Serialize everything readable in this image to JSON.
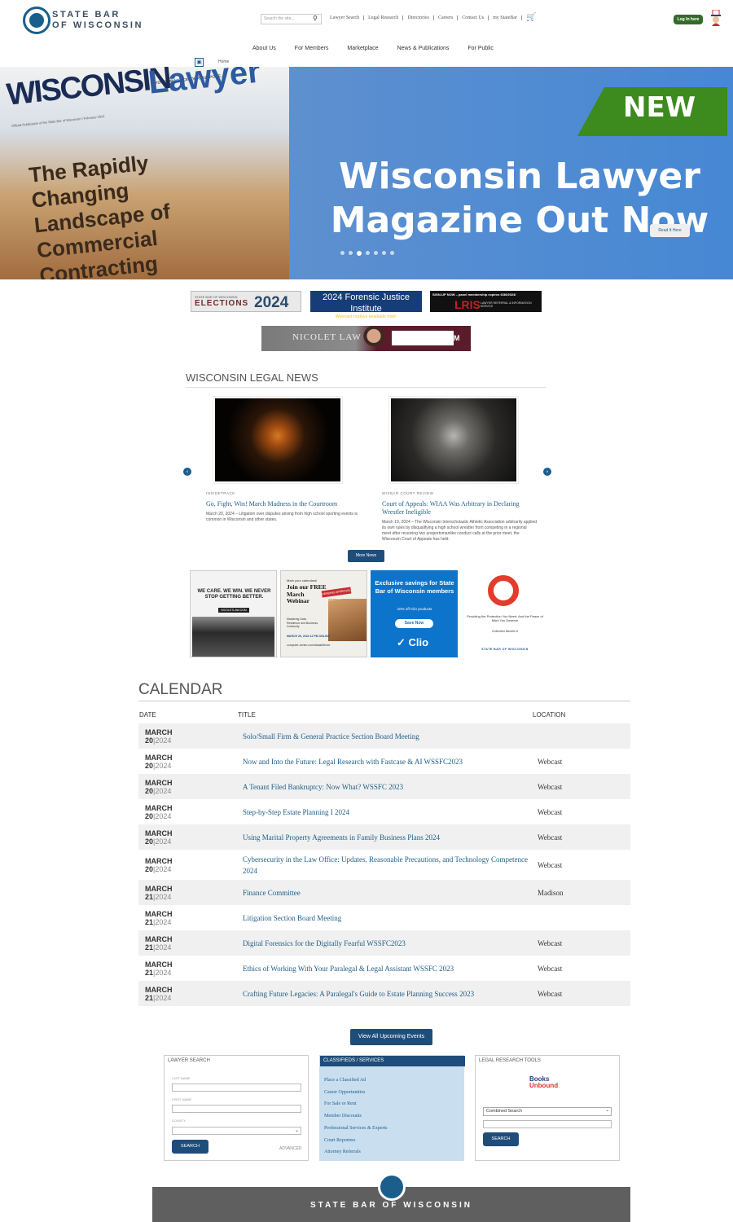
{
  "header": {
    "logo_line1": "STATE BAR",
    "logo_line2": "OF WISCONSIN",
    "search_placeholder": "Search the site...",
    "top_links": [
      "Lawyer Search",
      "Legal Research",
      "Directories",
      "Careers",
      "Contact Us",
      "my StateBar"
    ],
    "login_label": "Log In here"
  },
  "nav": {
    "items": [
      "About Us",
      "For Members",
      "Marketplace",
      "News & Publications",
      "For Public"
    ]
  },
  "breadcrumb": {
    "home": "Home"
  },
  "hero": {
    "magazine_tagline": "YOUR PRACTICE. OUR PURPOSE.",
    "magazine_title_a": "WISCONSIN",
    "magazine_title_b": "Lawyer",
    "magazine_sub": "Official Publication of the State Bar of Wisconsin | February 2024",
    "magazine_headline": "The Rapidly Changing Landscape of Commercial Contracting",
    "badge": "NEW",
    "title": "Wisconsin Lawyer Magazine Out Now",
    "cta": "Read It Here",
    "slide_count": 7,
    "active_slide": 3
  },
  "banners": {
    "elections_small": "STATE BAR OF WISCONSIN",
    "elections_label": "ELECTIONS",
    "elections_year": "2024",
    "forensic_title": "2024 Forensic Justice Institute",
    "forensic_sub": "Webcast replays available now!",
    "lris_top": "SIGN-UP NOW – panel membership expires 6/30/2024!",
    "lris_logo": "LRIS",
    "lris_desc": "LAWYER REFERRAL & INFORMATION SERVICE",
    "nicolet_name": "NICOLET LAW",
    "nicolet_url": "NICOLETLAW.COM"
  },
  "legal_news": {
    "heading": "WISCONSIN LEGAL NEWS",
    "articles": [
      {
        "category": "INSIDETRACK",
        "title": "Go, Fight, Win! March Madness in the Courtroom",
        "body": "March 20, 2024 – Litigation over disputes arising from high school sporting events is common in Wisconsin and other states."
      },
      {
        "category": "WISBAR COURT REVIEW",
        "title": "Court of Appeals: WIAA Was Arbitrary in Declaring Wrestler Ineligible",
        "body": "March 19, 2024 – The Wisconsin Interscholastic Athletic Association arbitrarily applied its own rules by disqualifying a high school wrestler from competing in a regional meet after receiving two unsportsmanlike conduct calls at the prior meet, the Wisconsin Court of Appeals has held."
      }
    ],
    "more_label": "More News"
  },
  "ads": {
    "ad1_headline": "WE CARE. WE WIN. WE NEVER STOP GETTING BETTER.",
    "ad1_url": "NICOLETLAW.COM",
    "ad2_mark": "Mark your calendars!",
    "ad2_join": "Join our FREE March Webinar",
    "ad2_pending": "PENDING APPROVAL CLE CREDITS",
    "ad2_sub": "Mastering Data Resilience and Business Continuity",
    "ad2_date": "MARCH 26, 2024 12 PM ONLINE",
    "ad2_url": "computer-center.com/datastillence",
    "ad3_headline": "Exclusive savings for State Bar of Wisconsin members",
    "ad3_sub": "10% off Clio products",
    "ad3_btn": "Save Now",
    "ad3_brand": "Clio",
    "ad4_tag": "Providing the Protection You Need, And the Peace of Mind You Deserve",
    "ad4_member": "A Member Benefit of",
    "ad4_org": "STATE BAR OF WISCONSIN"
  },
  "calendar": {
    "heading": "CALENDAR",
    "col_date": "DATE",
    "col_title": "TITLE",
    "col_location": "LOCATION",
    "rows": [
      {
        "month": "MARCH",
        "day": "20",
        "year": "2024",
        "title": "Solo/Small Firm & General Practice Section Board Meeting",
        "location": ""
      },
      {
        "month": "MARCH",
        "day": "20",
        "year": "2024",
        "title": "Now and Into the Future: Legal Research with Fastcase & AI WSSFC2023",
        "location": "Webcast"
      },
      {
        "month": "MARCH",
        "day": "20",
        "year": "2024",
        "title": "A Tenant Filed Bankruptcy: Now What? WSSFC 2023",
        "location": "Webcast"
      },
      {
        "month": "MARCH",
        "day": "20",
        "year": "2024",
        "title": "Step-by-Step Estate Planning I 2024",
        "location": "Webcast"
      },
      {
        "month": "MARCH",
        "day": "20",
        "year": "2024",
        "title": "Using Marital Property Agreements in Family Business Plans 2024",
        "location": "Webcast"
      },
      {
        "month": "MARCH",
        "day": "20",
        "year": "2024",
        "title": "Cybersecurity in the Law Office: Updates, Reasonable Precautions, and Technology Competence 2024",
        "location": "Webcast"
      },
      {
        "month": "MARCH",
        "day": "21",
        "year": "2024",
        "title": "Finance Committee",
        "location": "Madison"
      },
      {
        "month": "MARCH",
        "day": "21",
        "year": "2024",
        "title": "Litigation Section Board Meeting",
        "location": ""
      },
      {
        "month": "MARCH",
        "day": "21",
        "year": "2024",
        "title": "Digital Forensics for the Digitally Fearful WSSFC2023",
        "location": "Webcast"
      },
      {
        "month": "MARCH",
        "day": "21",
        "year": "2024",
        "title": "Ethics of Working With Your Paralegal & Legal Assistant WSSFC 2023",
        "location": "Webcast"
      },
      {
        "month": "MARCH",
        "day": "21",
        "year": "2024",
        "title": "Crafting Future Legacies: A Paralegal's Guide to Estate Planning Success 2023",
        "location": "Webcast"
      }
    ],
    "view_all": "View All Upcoming Events"
  },
  "lawyer_search": {
    "heading": "LAWYER SEARCH",
    "last_name": "LAST NAME",
    "first_name": "FIRST NAME",
    "county": "COUNTY",
    "search_btn": "SEARCH",
    "advanced": "ADVANCED"
  },
  "classifieds": {
    "heading": "CLASSIFIEDS / SERVICES",
    "links": [
      "Place a Classified Ad",
      "Career Opportunities",
      "For Sale or Rent",
      "Member Discounts",
      "Professional Services & Experts",
      "Court Reporters",
      "Attorney Referrals"
    ]
  },
  "research_tools": {
    "heading": "LEGAL RESEARCH TOOLS",
    "brand_a": "Books",
    "brand_b": "Unbound",
    "select_value": "Combined Search",
    "search_btn": "SEARCH"
  },
  "footer": {
    "org": "STATE BAR OF WISCONSIN"
  }
}
